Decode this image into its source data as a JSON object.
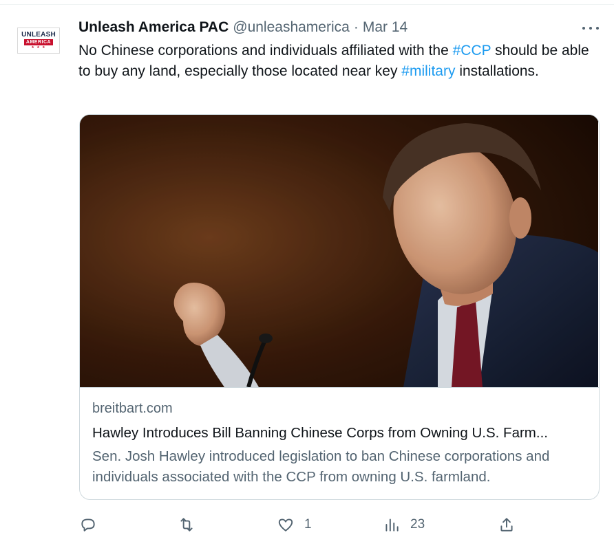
{
  "account": {
    "display_name": "Unleash America PAC",
    "handle": "@unleashamerica",
    "separator": "·",
    "date": "Mar 14",
    "avatar_logo": {
      "line1": "UNLEASH",
      "line2": "AMERICA",
      "line3": "★ ★ ★"
    }
  },
  "tweet": {
    "segments": [
      {
        "text": "No Chinese corporations and individuals affiliated with the ",
        "type": "text"
      },
      {
        "text": "#CCP",
        "type": "hashtag"
      },
      {
        "text": " should be able to buy any land, especially those located near key ",
        "type": "text"
      },
      {
        "text": "#military",
        "type": "hashtag"
      },
      {
        "text": " installations.",
        "type": "text"
      }
    ]
  },
  "card": {
    "domain": "breitbart.com",
    "title": "Hawley Introduces Bill Banning Chinese Corps from Owning U.S. Farm...",
    "description": "Sen. Josh Hawley introduced legislation to ban Chinese corporations and individuals associated with the CCP from owning U.S. farmland.",
    "image_icon": "photo-senator-speaking"
  },
  "actions": {
    "reply": {
      "icon": "reply-icon",
      "count": ""
    },
    "retweet": {
      "icon": "retweet-icon",
      "count": ""
    },
    "like": {
      "icon": "heart-icon",
      "count": "1"
    },
    "views": {
      "icon": "views-icon",
      "count": "23"
    },
    "share": {
      "icon": "share-icon",
      "count": ""
    }
  },
  "colors": {
    "text_primary": "#0f1419",
    "text_secondary": "#536471",
    "link": "#1d9bf0",
    "border": "#cfd9de"
  }
}
